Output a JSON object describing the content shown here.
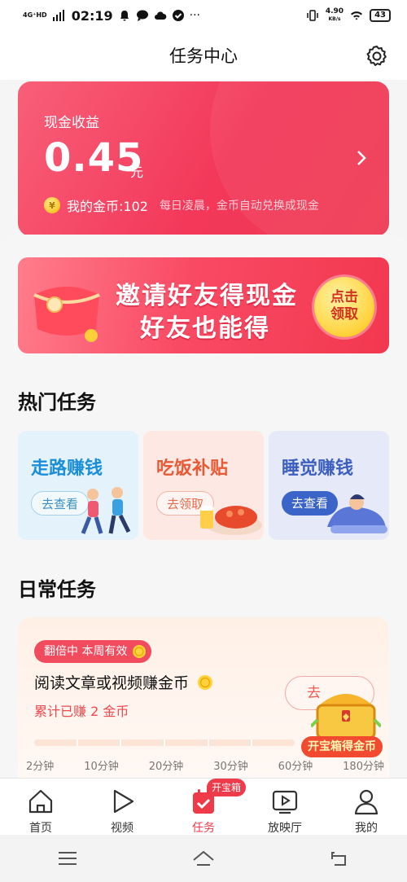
{
  "status_bar": {
    "network": "4G⁺HD",
    "time": "02:19",
    "speed_value": "4.90",
    "speed_unit": "KB/s",
    "battery": "43"
  },
  "header": {
    "title": "任务中心",
    "settings_icon": "gear-icon"
  },
  "cash_card": {
    "label": "现金收益",
    "amount": "0.45",
    "unit": "元",
    "coin_label": "我的金币:102",
    "coin_hint": "每日凌晨，金币自动兑换成现金",
    "coin_symbol": "¥"
  },
  "invite_banner": {
    "line1": "邀请好友得现金",
    "line2": "好友也能得",
    "claim_line1": "点击",
    "claim_line2": "领取"
  },
  "hot_tasks": {
    "title": "热门任务",
    "items": [
      {
        "name": "走路赚钱",
        "button": "去查看"
      },
      {
        "name": "吃饭补贴",
        "button": "去领取"
      },
      {
        "name": "睡觉赚钱",
        "button": "去查看"
      }
    ]
  },
  "daily_tasks": {
    "title": "日常任务",
    "badge": "翻倍中 本周有效",
    "task_name": "阅读文章或视频赚金币",
    "earned": "累计已赚 2 金币",
    "go_button": "去",
    "chest_label": "开宝箱得金币",
    "ticks": [
      "2分钟",
      "10分钟",
      "20分钟",
      "30分钟",
      "60分钟",
      "180分钟"
    ]
  },
  "tab_bar": {
    "badge": "开宝箱",
    "items": [
      {
        "label": "首页",
        "icon": "home-icon"
      },
      {
        "label": "视频",
        "icon": "play-icon"
      },
      {
        "label": "任务",
        "icon": "task-check-icon",
        "active": true
      },
      {
        "label": "放映厅",
        "icon": "tv-icon"
      },
      {
        "label": "我的",
        "icon": "person-icon"
      }
    ]
  },
  "colors": {
    "accent": "#ef3a4a",
    "card_red": "#f3385a"
  }
}
